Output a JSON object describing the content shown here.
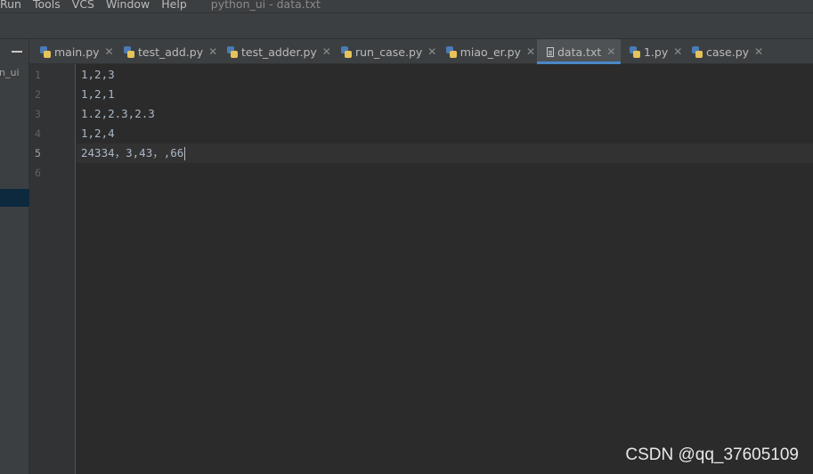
{
  "menu": {
    "items": [
      "Run",
      "Tools",
      "VCS",
      "Window",
      "Help"
    ],
    "window_title": "python_ui - data.txt"
  },
  "project_panel": {
    "label": "n_ui"
  },
  "tabs": [
    {
      "label": "main.py",
      "icon": "python-file-icon",
      "active": false
    },
    {
      "label": "test_add.py",
      "icon": "python-file-icon",
      "active": false
    },
    {
      "label": "test_adder.py",
      "icon": "python-file-icon",
      "active": false
    },
    {
      "label": "run_case.py",
      "icon": "python-file-icon",
      "active": false
    },
    {
      "label": "miao_er.py",
      "icon": "python-file-icon",
      "active": false
    },
    {
      "label": "data.txt",
      "icon": "text-file-icon",
      "active": true
    },
    {
      "label": "1.py",
      "icon": "python-file-icon",
      "active": false
    },
    {
      "label": "case.py",
      "icon": "python-file-icon",
      "active": false
    }
  ],
  "editor": {
    "line_numbers": [
      "1",
      "2",
      "3",
      "4",
      "5",
      "6"
    ],
    "lines": [
      "1,2,3",
      "1,2,1",
      "1.2,2.3,2.3",
      "1,2,4",
      "24334，3,43，,66",
      ""
    ],
    "current_line": 5
  },
  "watermark": "CSDN @qq_37605109",
  "colors": {
    "background": "#2b2b2b",
    "panel": "#3c3f41",
    "accent": "#4a88c7",
    "text": "#a9b7c6"
  }
}
